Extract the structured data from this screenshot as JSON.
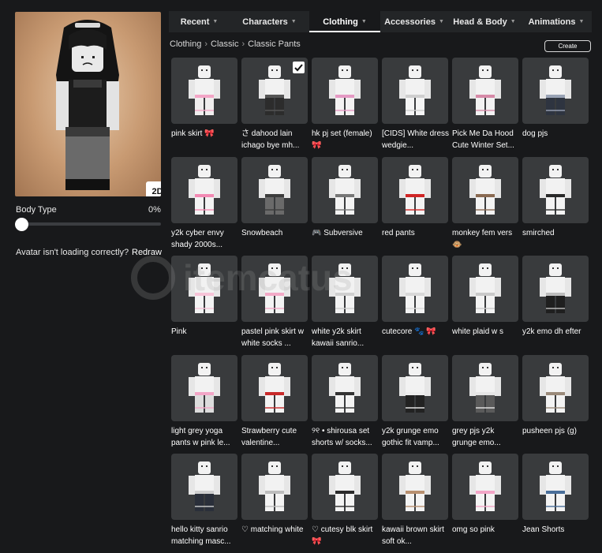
{
  "tabs": [
    {
      "label": "Recent",
      "active": false
    },
    {
      "label": "Characters",
      "active": false
    },
    {
      "label": "Clothing",
      "active": true
    },
    {
      "label": "Accessories",
      "active": false
    },
    {
      "label": "Head & Body",
      "active": false
    },
    {
      "label": "Animations",
      "active": false
    }
  ],
  "breadcrumb": [
    "Clothing",
    "Classic",
    "Classic Pants"
  ],
  "create_label": "Create",
  "preview": {
    "toggle_label": "2D"
  },
  "body_type": {
    "label": "Body Type",
    "value": "0%",
    "level": 0
  },
  "loading": {
    "text": "Avatar isn't loading correctly?",
    "link": "Redraw"
  },
  "watermark": "itemcatus",
  "items": [
    {
      "name": "pink skirt 🎀",
      "pants": "#f0eeee",
      "accent": "#f3a6c7",
      "checked": false
    },
    {
      "name": "さ dahood lain ichago bye mh...",
      "pants": "#2c2c2c",
      "accent": "#555555",
      "checked": true
    },
    {
      "name": "hk pj set (female) 🎀",
      "pants": "#f4f2f2",
      "accent": "#e59ac4",
      "checked": false
    },
    {
      "name": "[CIDS] White dress wedgie...",
      "pants": "#f5f5f5",
      "accent": "#cfcfcf",
      "checked": false
    },
    {
      "name": "Pick Me Da Hood Cute Winter Set...",
      "pants": "#f2f2f2",
      "accent": "#d68aa8",
      "checked": false
    },
    {
      "name": "dog pjs",
      "pants": "#2e3440",
      "accent": "#9aa3b5",
      "checked": false
    },
    {
      "name": "y2k cyber envy shady 2000s...",
      "pants": "#f3f3f3",
      "accent": "#f38ab4",
      "checked": false
    },
    {
      "name": "Snowbeach",
      "pants": "#6a6a6a",
      "accent": "#3d3d3d",
      "checked": false
    },
    {
      "name": "🎮 Subversive",
      "pants": "#f3f3f3",
      "accent": "#777777",
      "checked": false
    },
    {
      "name": "red pants",
      "pants": "#f3f3f3",
      "accent": "#d02626",
      "checked": false
    },
    {
      "name": "monkey fem vers 🐵",
      "pants": "#f3f3f3",
      "accent": "#8a6a52",
      "checked": false
    },
    {
      "name": "smirched",
      "pants": "#f3f3f3",
      "accent": "#2a2a2a",
      "checked": false
    },
    {
      "name": "Pink",
      "pants": "#f3f3f3",
      "accent": "#f7c4d8",
      "checked": false
    },
    {
      "name": "pastel pink skirt w white socks ...",
      "pants": "#f3f3f3",
      "accent": "#f3aac7",
      "checked": false
    },
    {
      "name": "white y2k skirt kawaii sanrio...",
      "pants": "#f3f3f3",
      "accent": "#cfcfcf",
      "checked": false
    },
    {
      "name": "cutecore 🐾 🎀",
      "pants": "#f3f3f3",
      "accent": "#d8d8d8",
      "checked": false
    },
    {
      "name": "white plaid w s",
      "pants": "#f3f3f3",
      "accent": "#c9c9c9",
      "checked": false
    },
    {
      "name": "y2k emo dh efter",
      "pants": "#1f1f1f",
      "accent": "#bdbdbd",
      "checked": false
    },
    {
      "name": "light grey yoga pants w pink le...",
      "pants": "#dcdcdc",
      "accent": "#f3a6c7",
      "checked": false
    },
    {
      "name": "Strawberry cute valentine...",
      "pants": "#f3f3f3",
      "accent": "#c82a2a",
      "checked": false
    },
    {
      "name": "୨୧ • shirousa set shorts w/ socks...",
      "pants": "#f3f3f3",
      "accent": "#333333",
      "checked": false
    },
    {
      "name": "y2k grunge emo gothic fit vamp...",
      "pants": "#222222",
      "accent": "#eeeeee",
      "checked": false
    },
    {
      "name": "grey pjs y2k grunge emo...",
      "pants": "#5a5a5a",
      "accent": "#e6e6e6",
      "checked": false
    },
    {
      "name": "pusheen pjs (g)",
      "pants": "#f3f3f3",
      "accent": "#9a8a7a",
      "checked": false
    },
    {
      "name": "hello kitty sanrio matching masc...",
      "pants": "#2a2f3a",
      "accent": "#cfcfcf",
      "checked": false
    },
    {
      "name": "♡ matching white",
      "pants": "#f3f3f3",
      "accent": "#bdbdbd",
      "checked": false
    },
    {
      "name": "♡ cutesy blk skirt 🎀",
      "pants": "#f3f3f3",
      "accent": "#2a2a2a",
      "checked": false
    },
    {
      "name": "kawaii brown skirt soft ok...",
      "pants": "#f3f3f3",
      "accent": "#b89070",
      "checked": false
    },
    {
      "name": "omg so pink",
      "pants": "#f3f3f3",
      "accent": "#f3a6c7",
      "checked": false
    },
    {
      "name": "Jean Shorts",
      "pants": "#f3f3f3",
      "accent": "#4a6f9a",
      "checked": false
    }
  ]
}
